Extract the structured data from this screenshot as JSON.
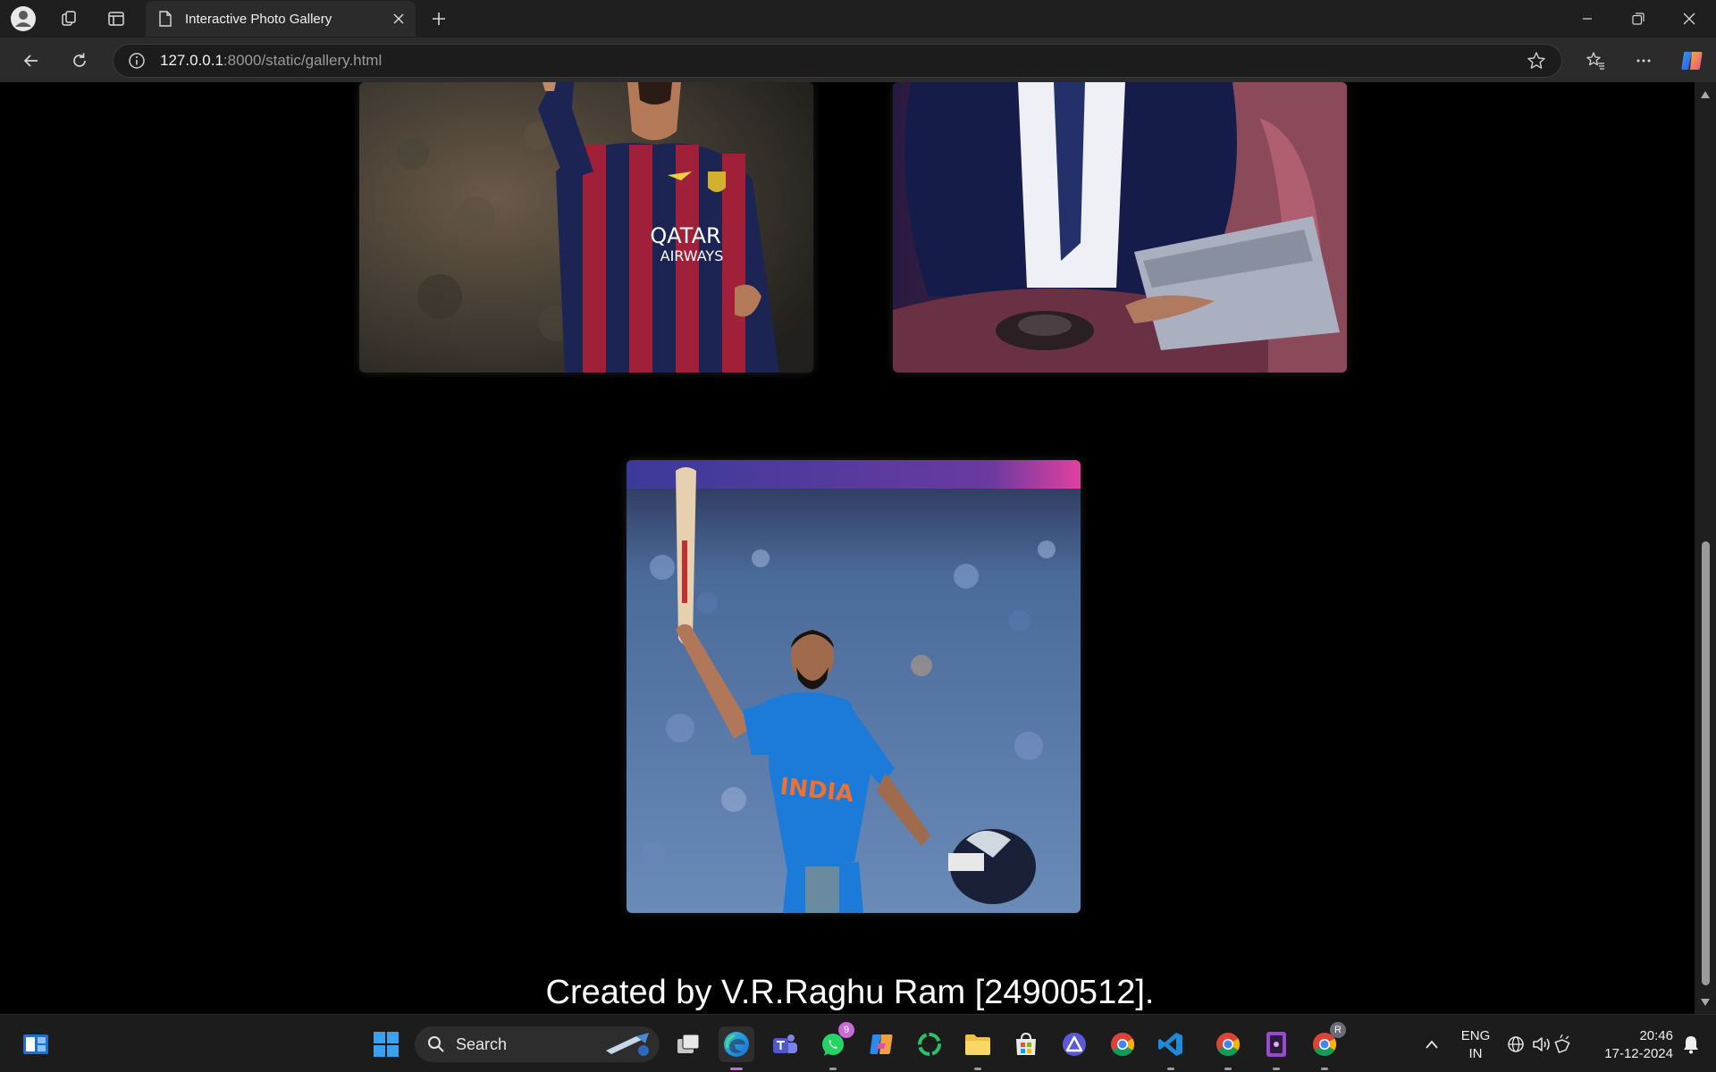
{
  "browser": {
    "tab_title": "Interactive Photo Gallery",
    "url_host": "127.0.0.1",
    "url_rest": ":8000/static/gallery.html"
  },
  "gallery": {
    "photos": [
      {
        "subject": "footballer in Barcelona kit",
        "jersey_text_1": "QATAR",
        "jersey_text_2": "AIRWAYS"
      },
      {
        "subject": "man in suit with laptop in car"
      },
      {
        "subject": "cricketer raising bat",
        "jersey_text": "INDIA"
      }
    ],
    "caption": "Created by V.R.Raghu Ram [24900512]."
  },
  "taskbar": {
    "search_label": "Search",
    "whatsapp_badge": "9",
    "chrome_profile_badge": "R",
    "language_line1": "ENG",
    "language_line2": "IN",
    "time": "20:46",
    "date": "17-12-2024"
  }
}
